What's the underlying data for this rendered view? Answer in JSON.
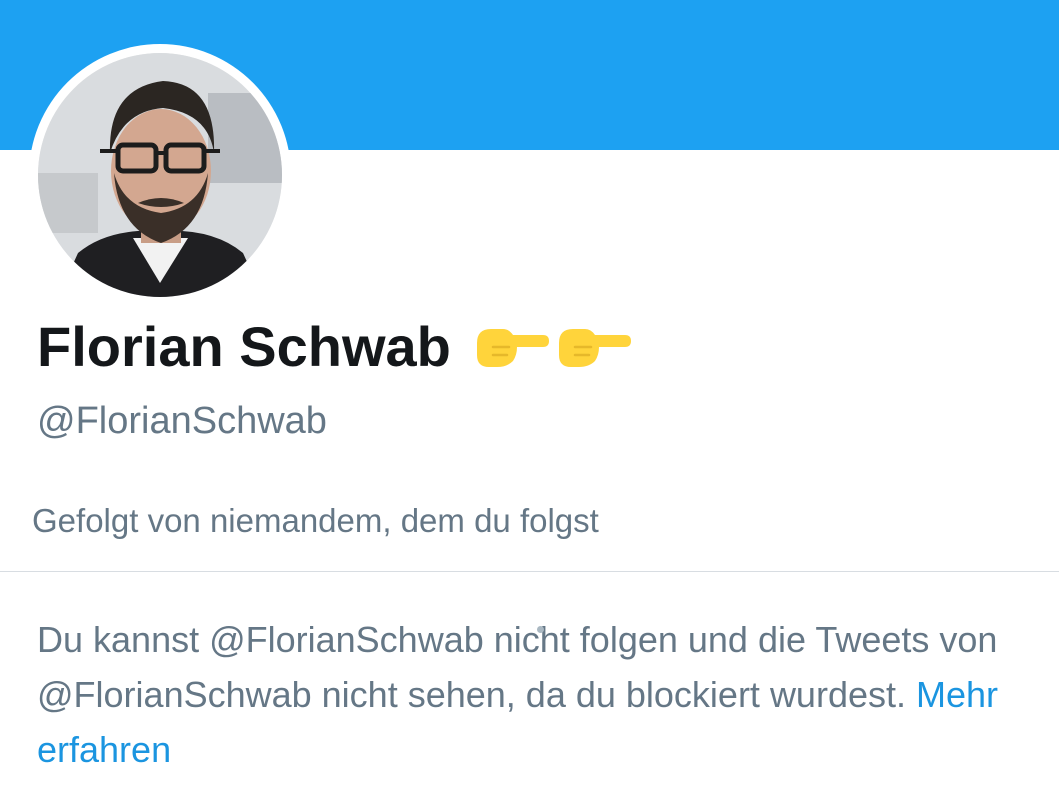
{
  "profile": {
    "display_name": "Florian Schwab",
    "handle": "@FlorianSchwab",
    "emoji_icons": [
      "pointing-right-hand-emoji",
      "pointing-right-hand-emoji"
    ]
  },
  "followers_context": "Gefolgt von niemandem, dem du folgst",
  "blocked": {
    "message": "Du kannst @FlorianSchwab nicht folgen und die Tweets von @FlorianSchwab nicht sehen, da du blockiert wurdest.",
    "learn_more_label": "Mehr erfahren"
  },
  "colors": {
    "banner": "#1da1f2",
    "name": "#14171a",
    "secondary_text": "#657786",
    "link": "#1b95e0",
    "emoji": "#ffd43b"
  }
}
